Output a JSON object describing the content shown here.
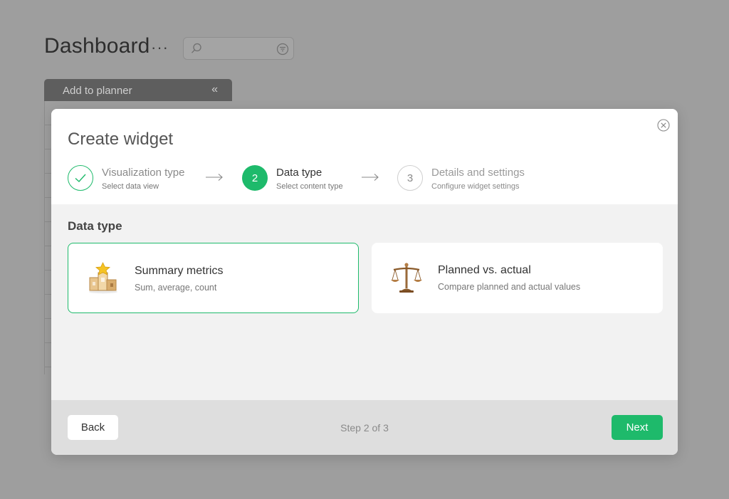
{
  "background": {
    "title": "Dashboard",
    "more_glyph": "···",
    "search": {
      "placeholder": ""
    },
    "panel": {
      "label": "Add to planner",
      "collapse_glyph": "«"
    }
  },
  "modal": {
    "title": "Create widget",
    "steps": [
      {
        "number": "1",
        "title": "Visualization type",
        "subtitle": "Select data view",
        "state": "completed"
      },
      {
        "number": "2",
        "title": "Data type",
        "subtitle": "Select content type",
        "state": "active"
      },
      {
        "number": "3",
        "title": "Details and settings",
        "subtitle": "Configure widget settings",
        "state": "pending"
      }
    ],
    "section_title": "Data type",
    "options": [
      {
        "title": "Summary metrics",
        "subtitle": "Sum, average, count",
        "icon": "podium-trophy-icon",
        "selected": true
      },
      {
        "title": "Planned vs. actual",
        "subtitle": "Compare planned and actual values",
        "icon": "scales-icon",
        "selected": false
      }
    ],
    "footer": {
      "back_label": "Back",
      "step_indicator": "Step 2 of 3",
      "next_label": "Next"
    }
  },
  "colors": {
    "accent": "#1eba6b",
    "overlay": "#9e9e9e",
    "modal_bg": "#f2f2f2",
    "footer_bg": "#dedede"
  }
}
